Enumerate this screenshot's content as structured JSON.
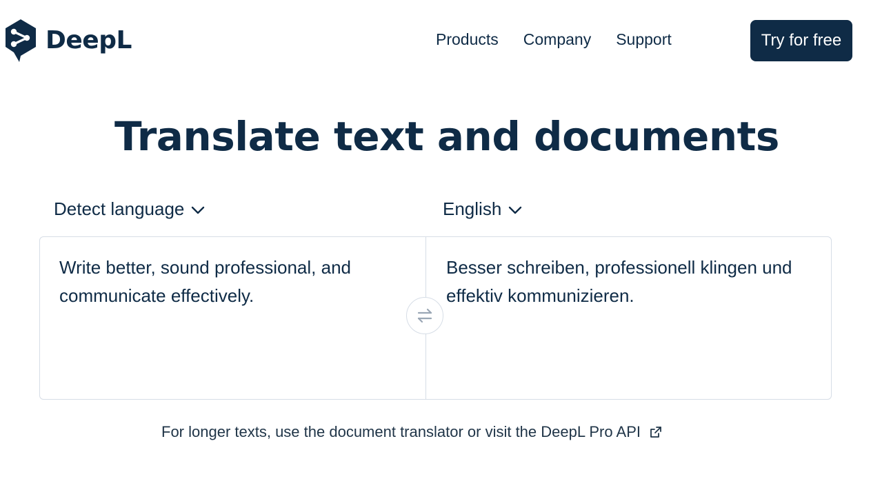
{
  "header": {
    "brand": "DeepL",
    "nav": [
      {
        "label": "Products"
      },
      {
        "label": "Company"
      },
      {
        "label": "Support"
      }
    ],
    "cta_label": "Try for free"
  },
  "title": "Translate text and documents",
  "translator": {
    "source_language": "Detect language",
    "target_language": "English",
    "source_text": "Write better, sound professional, and communicate effectively.",
    "target_text": "Besser schreiben, professionell klingen und effektiv kommunizieren."
  },
  "footer_note": {
    "text": "For longer texts, use the document translator or visit the DeepL Pro API"
  },
  "icons": {
    "logo": "deepl-logo-icon",
    "language_dropdown": "chevron-down-icon",
    "swap": "swap-arrows-icon",
    "external_link": "external-link-icon"
  },
  "colors": {
    "brand_navy": "#0f2b46",
    "border": "#d6dde6",
    "background": "#ffffff",
    "swap_icon": "#9aa7b5"
  }
}
